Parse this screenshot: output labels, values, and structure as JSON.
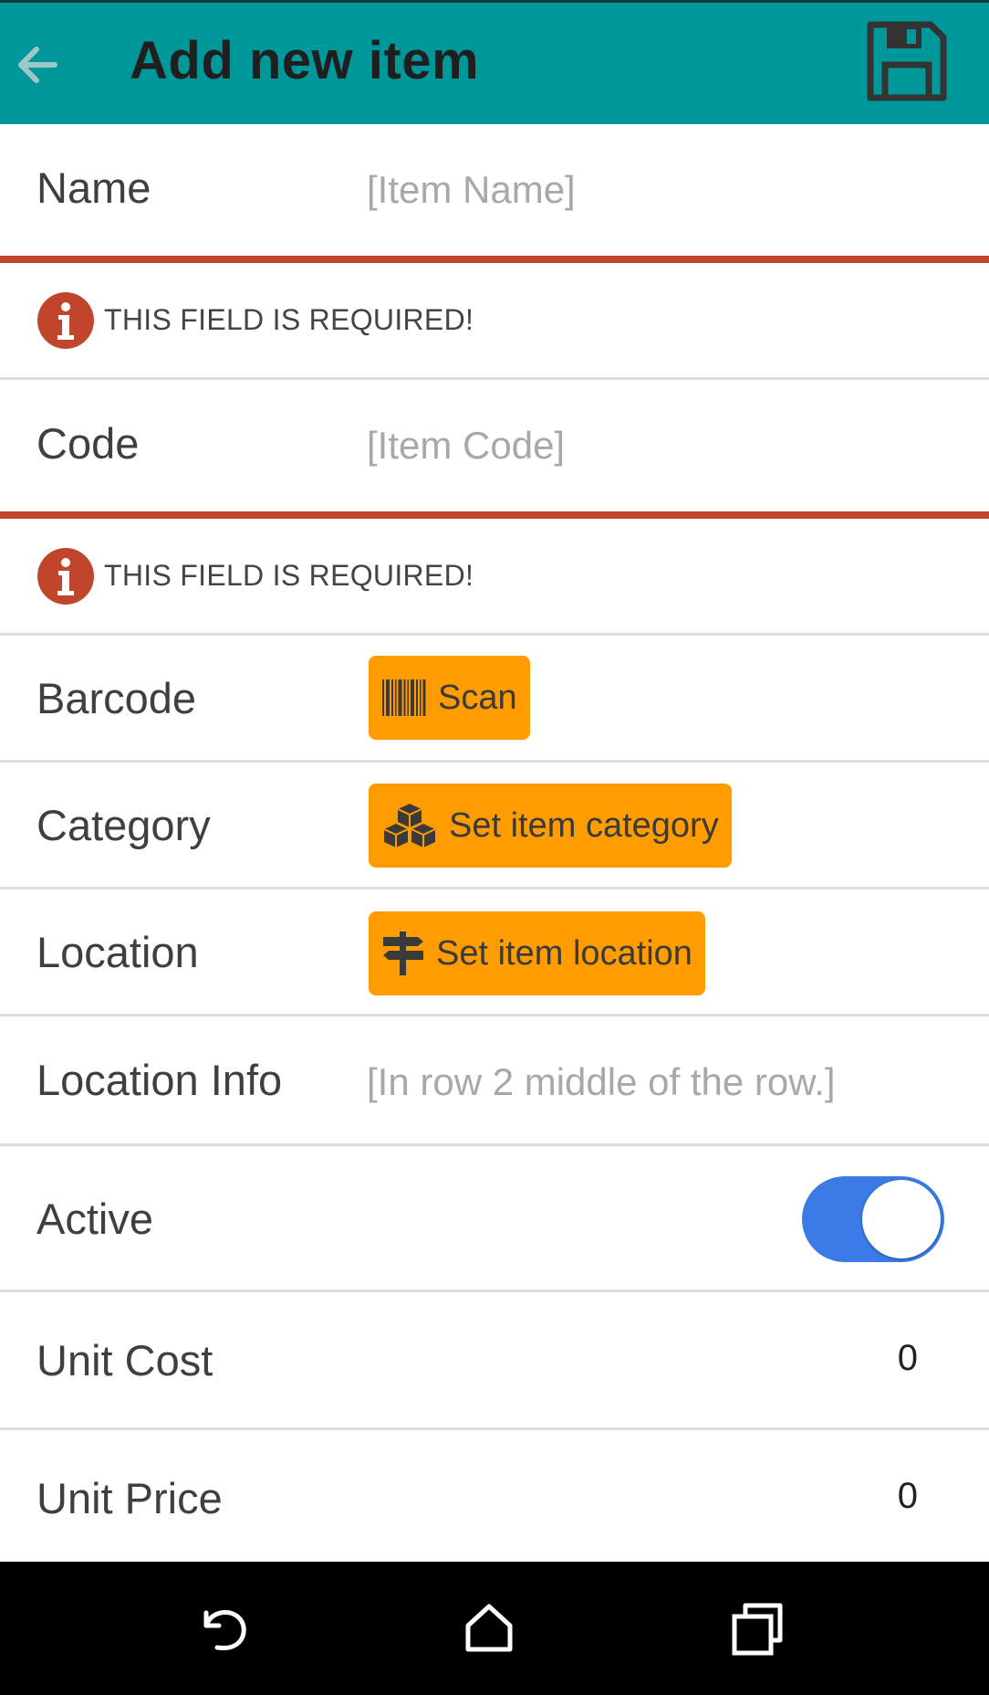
{
  "appbar": {
    "title": "Add new item",
    "back_icon": "arrow-left-icon",
    "save_icon": "floppy-disk-icon",
    "color": "#00979a"
  },
  "fields": {
    "name": {
      "label": "Name",
      "placeholder": "[Item Name]",
      "value": ""
    },
    "name_error": "THIS FIELD IS REQUIRED!",
    "code": {
      "label": "Code",
      "placeholder": "[Item Code]",
      "value": ""
    },
    "code_error": "THIS FIELD IS REQUIRED!",
    "barcode": {
      "label": "Barcode",
      "button": "Scan",
      "icon": "barcode-icon"
    },
    "category": {
      "label": "Category",
      "button": "Set item category",
      "icon": "cubes-icon"
    },
    "location": {
      "label": "Location",
      "button": "Set item location",
      "icon": "signpost-icon"
    },
    "location_info": {
      "label": "Location Info",
      "placeholder": "[In row 2 middle of the row.]",
      "value": ""
    },
    "active": {
      "label": "Active",
      "on": true
    },
    "unit_cost": {
      "label": "Unit Cost",
      "value": "0"
    },
    "unit_price": {
      "label": "Unit Price",
      "value": "0"
    }
  },
  "colors": {
    "error": "#c0452a",
    "button": "#ff9c00",
    "toggle": "#3a7be6"
  },
  "navbar": {
    "back": "nav-back-icon",
    "home": "nav-home-icon",
    "recents": "nav-recents-icon"
  }
}
